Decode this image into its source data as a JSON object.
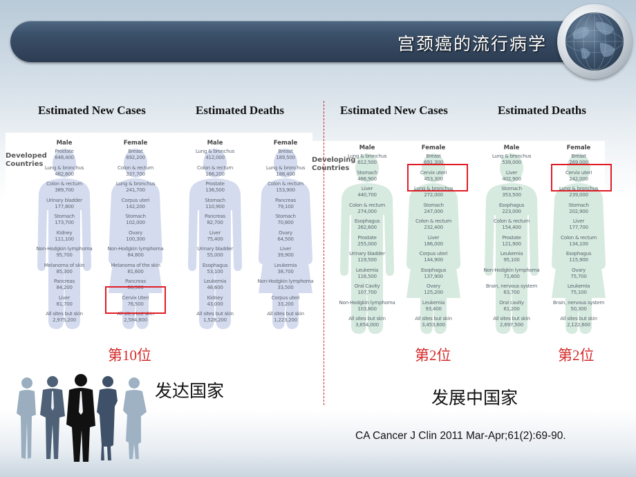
{
  "header": {
    "title": "宫颈癌的流行病学",
    "icon": "globe-icon"
  },
  "column_headers": [
    "Estimated  New Cases",
    "Estimated  Deaths",
    "Estimated  New Cases",
    "Estimated  Deaths"
  ],
  "colors": {
    "developed_figure": "#d4dbee",
    "developing_figure": "#d6eadf",
    "highlight": "#e01b24",
    "rank_text": "#d42a2a",
    "divider": "#c8202a"
  },
  "developed": {
    "label": "Developed\nCountries",
    "new_cases": {
      "male": {
        "sex": "Male",
        "items": [
          {
            "site": "Prostate",
            "value": "648,400"
          },
          {
            "site": "Lung & bronchus",
            "value": "482,600"
          },
          {
            "site": "Colon & rectum",
            "value": "389,700"
          },
          {
            "site": "Urinary bladder",
            "value": "177,800"
          },
          {
            "site": "Stomach",
            "value": "173,700"
          },
          {
            "site": "Kidney",
            "value": "111,100"
          },
          {
            "site": "Non-Hodgkin lymphoma",
            "value": "95,700"
          },
          {
            "site": "Melanoma of skin",
            "value": "85,300"
          },
          {
            "site": "Pancreas",
            "value": "84,200"
          },
          {
            "site": "Liver",
            "value": "81,700"
          },
          {
            "site": "All sites but skin",
            "value": "2,975,200"
          }
        ]
      },
      "female": {
        "sex": "Female",
        "items": [
          {
            "site": "Breast",
            "value": "692,200"
          },
          {
            "site": "Colon & rectum",
            "value": "337,700"
          },
          {
            "site": "Lung & bronchus",
            "value": "241,700"
          },
          {
            "site": "Corpus uteri",
            "value": "142,200"
          },
          {
            "site": "Stomach",
            "value": "102,000"
          },
          {
            "site": "Ovary",
            "value": "100,300"
          },
          {
            "site": "Non-Hodgkin lymphoma",
            "value": "84,800"
          },
          {
            "site": "Melanoma of the skin",
            "value": "81,600"
          },
          {
            "site": "Pancreas",
            "value": "80,500"
          },
          {
            "site": "Cervix Uteri",
            "value": "76,500"
          },
          {
            "site": "All sites but skin",
            "value": "2,584,800"
          }
        ]
      }
    },
    "deaths": {
      "male": {
        "sex": "Male",
        "items": [
          {
            "site": "Lung & bronchus",
            "value": "412,000"
          },
          {
            "site": "Colon & rectum",
            "value": "166,200"
          },
          {
            "site": "Prostate",
            "value": "136,500"
          },
          {
            "site": "Stomach",
            "value": "110,900"
          },
          {
            "site": "Pancreas",
            "value": "82,700"
          },
          {
            "site": "Liver",
            "value": "75,400"
          },
          {
            "site": "Urinary bladder",
            "value": "55,000"
          },
          {
            "site": "Esophagus",
            "value": "53,100"
          },
          {
            "site": "Leukemia",
            "value": "48,600"
          },
          {
            "site": "Kidney",
            "value": "43,000"
          },
          {
            "site": "All sites but skin",
            "value": "1,528,200"
          }
        ]
      },
      "female": {
        "sex": "Female",
        "items": [
          {
            "site": "Breast",
            "value": "189,500"
          },
          {
            "site": "Lung & bronchus",
            "value": "188,400"
          },
          {
            "site": "Colon & rectum",
            "value": "153,900"
          },
          {
            "site": "Pancreas",
            "value": "79,100"
          },
          {
            "site": "Stomach",
            "value": "70,800"
          },
          {
            "site": "Ovary",
            "value": "64,500"
          },
          {
            "site": "Liver",
            "value": "39,900"
          },
          {
            "site": "Leukemia",
            "value": "38,700"
          },
          {
            "site": "Non-Hodgkin lymphoma",
            "value": "33,500"
          },
          {
            "site": "Corpus uteri",
            "value": "33,200"
          },
          {
            "site": "All sites but skin",
            "value": "1,223,200"
          }
        ]
      }
    },
    "rank": "第10位",
    "country_label": "发达国家"
  },
  "developing": {
    "label": "Developing\nCountries",
    "new_cases": {
      "male": {
        "sex": "Male",
        "items": [
          {
            "site": "Lung & bronchus",
            "value": "612,500"
          },
          {
            "site": "Stomach",
            "value": "466,900"
          },
          {
            "site": "Liver",
            "value": "440,700"
          },
          {
            "site": "Colon & rectum",
            "value": "274,000"
          },
          {
            "site": "Esophagus",
            "value": "262,600"
          },
          {
            "site": "Prostate",
            "value": "255,000"
          },
          {
            "site": "Urinary bladder",
            "value": "119,500"
          },
          {
            "site": "Leukemia",
            "value": "116,500"
          },
          {
            "site": "Oral Cavity",
            "value": "107,700"
          },
          {
            "site": "Non-Hodgkin lymphoma",
            "value": "103,800"
          },
          {
            "site": "All sites but skin",
            "value": "3,654,000"
          }
        ]
      },
      "female": {
        "sex": "Female",
        "items": [
          {
            "site": "Breast",
            "value": "691,300"
          },
          {
            "site": "Cervix uteri",
            "value": "453,300"
          },
          {
            "site": "Lung & bronchus",
            "value": "272,000"
          },
          {
            "site": "Stomach",
            "value": "247,000"
          },
          {
            "site": "Colon & rectum",
            "value": "232,400"
          },
          {
            "site": "Liver",
            "value": "186,000"
          },
          {
            "site": "Corpus uteri",
            "value": "144,900"
          },
          {
            "site": "Esophagus",
            "value": "137,900"
          },
          {
            "site": "Ovary",
            "value": "125,200"
          },
          {
            "site": "Leukemia",
            "value": "93,400"
          },
          {
            "site": "All sites but skin",
            "value": "3,453,600"
          }
        ]
      }
    },
    "deaths": {
      "male": {
        "sex": "Male",
        "items": [
          {
            "site": "Lung & bronchus",
            "value": "539,000"
          },
          {
            "site": "Liver",
            "value": "402,900"
          },
          {
            "site": "Stomach",
            "value": "353,500"
          },
          {
            "site": "Esophagus",
            "value": "223,000"
          },
          {
            "site": "Colon & rectum",
            "value": "154,400"
          },
          {
            "site": "Prostate",
            "value": "121,900"
          },
          {
            "site": "Leukemia",
            "value": "95,100"
          },
          {
            "site": "Non-Hodgkin lymphoma",
            "value": "71,600"
          },
          {
            "site": "Brain, nervous system",
            "value": "63,700"
          },
          {
            "site": "Oral cavity",
            "value": "61,200"
          },
          {
            "site": "All sites but skin",
            "value": "2,697,500"
          }
        ]
      },
      "female": {
        "sex": "Female",
        "items": [
          {
            "site": "Breast",
            "value": "269,000"
          },
          {
            "site": "Cervix uteri",
            "value": "242,000"
          },
          {
            "site": "Lung & bronchus",
            "value": "239,000"
          },
          {
            "site": "Stomach",
            "value": "202,900"
          },
          {
            "site": "Liver",
            "value": "177,700"
          },
          {
            "site": "Colon & rectum",
            "value": "134,100"
          },
          {
            "site": "Esophagus",
            "value": "115,900"
          },
          {
            "site": "Ovary",
            "value": "75,700"
          },
          {
            "site": "Leukemia",
            "value": "75,100"
          },
          {
            "site": "Brain, nervous system",
            "value": "50,300"
          },
          {
            "site": "All sites but skin",
            "value": "2,122,600"
          }
        ]
      }
    },
    "rank_new_cases": "第2位",
    "rank_deaths": "第2位",
    "country_label": "发展中国家"
  },
  "citation": "CA Cancer J Clin 2011 Mar-Apr;61(2):69-90.",
  "decoration": {
    "people_icon": "business-people-silhouettes-icon"
  }
}
